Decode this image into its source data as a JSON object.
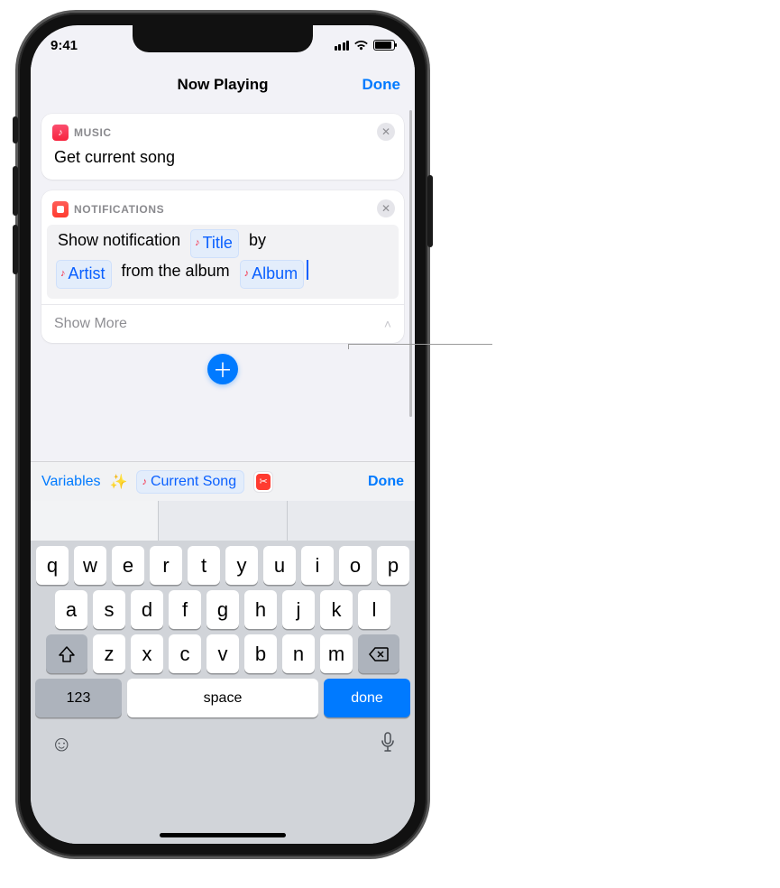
{
  "statusbar": {
    "time": "9:41"
  },
  "navbar": {
    "title": "Now Playing",
    "done": "Done"
  },
  "cards": {
    "music": {
      "app": "MUSIC",
      "title": "Get current song"
    },
    "notif": {
      "app": "NOTIFICATIONS",
      "prefix": "Show notification",
      "token_title": "Title",
      "mid1": "by",
      "token_artist": "Artist",
      "mid2": "from the album",
      "token_album": "Album",
      "showMore": "Show More"
    }
  },
  "varbar": {
    "variables": "Variables",
    "currentSong": "Current Song",
    "done": "Done"
  },
  "keyboard": {
    "row1": [
      "q",
      "w",
      "e",
      "r",
      "t",
      "y",
      "u",
      "i",
      "o",
      "p"
    ],
    "row2": [
      "a",
      "s",
      "d",
      "f",
      "g",
      "h",
      "j",
      "k",
      "l"
    ],
    "row3": [
      "z",
      "x",
      "c",
      "v",
      "b",
      "n",
      "m"
    ],
    "num": "123",
    "space": "space",
    "done": "done"
  }
}
